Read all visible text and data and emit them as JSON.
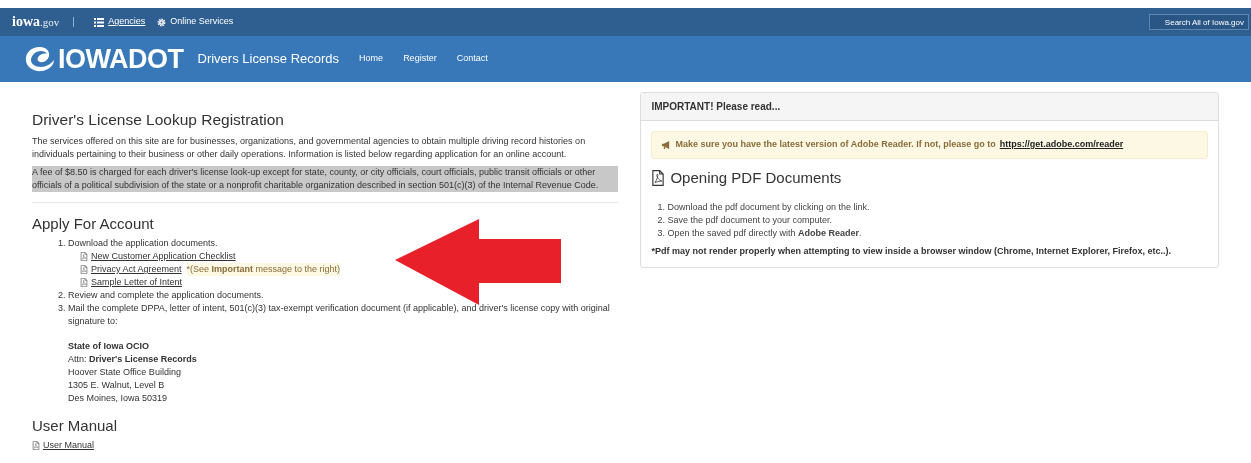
{
  "top_bar": {
    "logo": "iowa",
    "logo_suffix": ".gov",
    "links": [
      {
        "label": "Agencies",
        "kind": "list",
        "underlined": true
      },
      {
        "label": "Online Services",
        "kind": "gear",
        "underlined": false
      }
    ],
    "search": {
      "placeholder": "Search All of Iowa.gov"
    }
  },
  "nav": {
    "brand": "IOWADOT",
    "title": "Drivers License Records",
    "links": [
      "Home",
      "Register",
      "Contact"
    ]
  },
  "main": {
    "title": "Driver's License Lookup Registration",
    "intro": "The services offered on this site are for businesses, organizations, and governmental agencies to obtain multiple driving record histories on individuals pertaining to their business or other daily operations. Information is listed below regarding application for an online account.",
    "fee_notice": "A fee of $8.50 is charged for each driver's license look-up except for state, county, or city officials, court officials, public transit officials or other officials of a political subdivision of the state or a nonprofit charitable organization described in section 501(c)(3) of the Internal Revenue Code.",
    "apply_title": "Apply For Account",
    "steps": [
      {
        "number": "1.",
        "text": "Download the application documents.",
        "documents": [
          {
            "label": "New Customer Application Checklist"
          },
          {
            "label": "Privacy Act Agreement",
            "note": "*(See **Important** message to the right)"
          },
          {
            "label": "Sample Letter of Intent"
          }
        ]
      },
      {
        "number": "2.",
        "text": "Review and complete the application documents."
      },
      {
        "number": "3.",
        "text": "Mail the complete DPPA, letter of intent, 501(c)(3) tax-exempt verification document (if applicable), and driver's license copy with original signature to:"
      }
    ],
    "address": [
      "**State of Iowa OCIO**",
      "Attn: **Driver's License Records**",
      "Hoover State Office Building",
      "1305 E. Walnut, Level B",
      "Des Moines, Iowa 50319"
    ],
    "manual_title": "User Manual",
    "manual_link": "User Manual"
  },
  "panel": {
    "heading": "IMPORTANT! Please read...",
    "alert": {
      "text": "Make sure you have the latest version of Adobe Reader. If not, please go to",
      "link": "https://get.adobe.com/reader"
    },
    "title": "Opening PDF Documents",
    "steps": [
      {
        "number": "1.",
        "text": "Download the pdf document by clicking on the link."
      },
      {
        "number": "2.",
        "text": "Save the pdf document to your computer."
      },
      {
        "number": "3.",
        "text": "Open the saved pdf directly with **Adobe Reader**."
      }
    ],
    "footnote": "*Pdf may not render properly when attempting to view inside a browser window (Chrome, Internet Explorer, Firefox, etc..)."
  }
}
